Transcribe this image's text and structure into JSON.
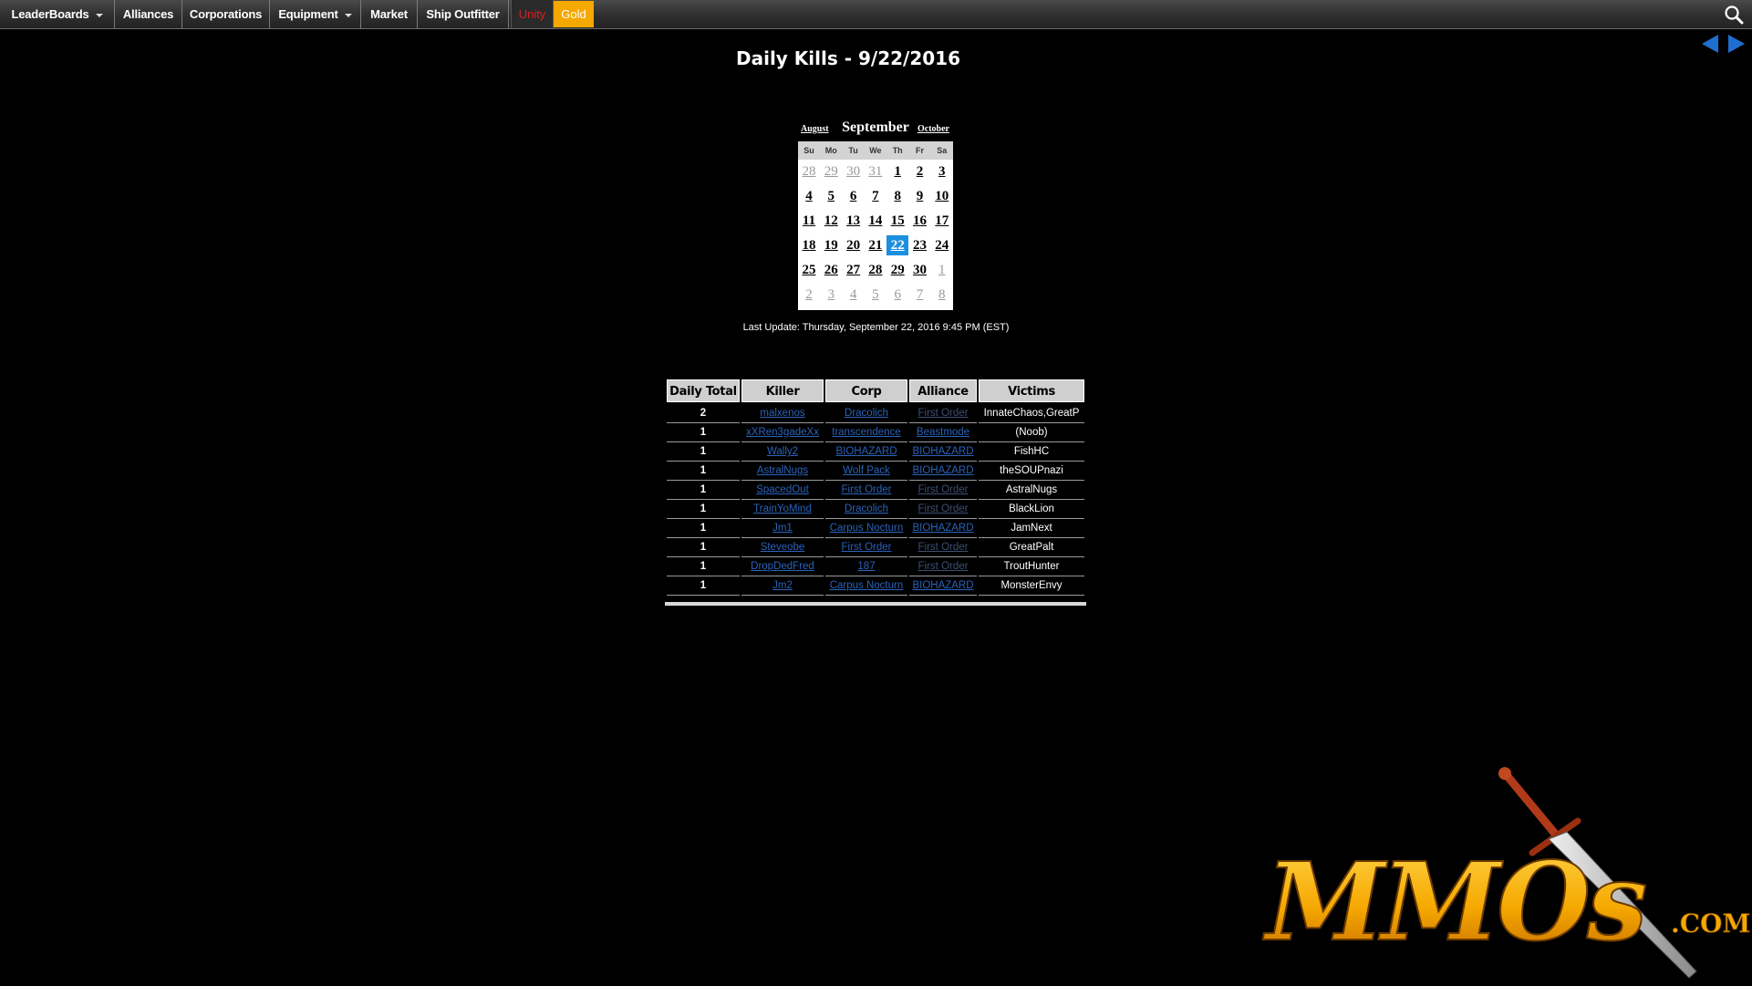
{
  "nav": {
    "items": [
      {
        "label": "LeaderBoards",
        "dropdown": true
      },
      {
        "label": "Alliances",
        "dropdown": false
      },
      {
        "label": "Corporations",
        "dropdown": false
      },
      {
        "label": "Equipment",
        "dropdown": true
      },
      {
        "label": "Market",
        "dropdown": false
      },
      {
        "label": "Ship Outfitter",
        "dropdown": false
      }
    ],
    "unity_label": "Unity",
    "gold_label": "Gold",
    "search_icon": "search-icon"
  },
  "page": {
    "title": "Daily Kills - 9/22/2016",
    "prev_icon": "left-arrow-icon",
    "next_icon": "right-arrow-icon"
  },
  "calendar": {
    "prev_month": "August",
    "month": "September",
    "next_month": "October",
    "weekdays": [
      "Su",
      "Mo",
      "Tu",
      "We",
      "Th",
      "Fr",
      "Sa"
    ],
    "weeks": [
      [
        {
          "d": "28",
          "cur": false
        },
        {
          "d": "29",
          "cur": false
        },
        {
          "d": "30",
          "cur": false
        },
        {
          "d": "31",
          "cur": false
        },
        {
          "d": "1",
          "cur": true
        },
        {
          "d": "2",
          "cur": true
        },
        {
          "d": "3",
          "cur": true
        }
      ],
      [
        {
          "d": "4",
          "cur": true
        },
        {
          "d": "5",
          "cur": true
        },
        {
          "d": "6",
          "cur": true
        },
        {
          "d": "7",
          "cur": true
        },
        {
          "d": "8",
          "cur": true
        },
        {
          "d": "9",
          "cur": true
        },
        {
          "d": "10",
          "cur": true
        }
      ],
      [
        {
          "d": "11",
          "cur": true
        },
        {
          "d": "12",
          "cur": true
        },
        {
          "d": "13",
          "cur": true
        },
        {
          "d": "14",
          "cur": true
        },
        {
          "d": "15",
          "cur": true
        },
        {
          "d": "16",
          "cur": true
        },
        {
          "d": "17",
          "cur": true
        }
      ],
      [
        {
          "d": "18",
          "cur": true
        },
        {
          "d": "19",
          "cur": true
        },
        {
          "d": "20",
          "cur": true
        },
        {
          "d": "21",
          "cur": true
        },
        {
          "d": "22",
          "cur": true,
          "selected": true
        },
        {
          "d": "23",
          "cur": true
        },
        {
          "d": "24",
          "cur": true
        }
      ],
      [
        {
          "d": "25",
          "cur": true
        },
        {
          "d": "26",
          "cur": true
        },
        {
          "d": "27",
          "cur": true
        },
        {
          "d": "28",
          "cur": true
        },
        {
          "d": "29",
          "cur": true
        },
        {
          "d": "30",
          "cur": true
        },
        {
          "d": "1",
          "cur": false
        }
      ],
      [
        {
          "d": "2",
          "cur": false
        },
        {
          "d": "3",
          "cur": false
        },
        {
          "d": "4",
          "cur": false
        },
        {
          "d": "5",
          "cur": false
        },
        {
          "d": "6",
          "cur": false
        },
        {
          "d": "7",
          "cur": false
        },
        {
          "d": "8",
          "cur": false
        }
      ]
    ],
    "selected_color": "#1b8fe0"
  },
  "last_update": "Last Update: Thursday, September 22, 2016 9:45 PM (EST)",
  "kills_table": {
    "headers": [
      "Daily Total",
      "Killer",
      "Corp",
      "Alliance",
      "Victims"
    ],
    "rows": [
      {
        "total": "2",
        "killer": "malxenos",
        "corp": "Dracolich",
        "alliance": "First Order",
        "alliance_dim": true,
        "victims": "InnateChaos,GreatP"
      },
      {
        "total": "1",
        "killer": "xXRen3gadeXx",
        "corp": "transcendence",
        "alliance": "Beastmode",
        "alliance_dim": false,
        "victims": "(Noob)"
      },
      {
        "total": "1",
        "killer": "Wally2",
        "corp": "BIOHAZARD",
        "alliance": "BIOHAZARD",
        "alliance_dim": false,
        "victims": "FishHC"
      },
      {
        "total": "1",
        "killer": "AstralNugs",
        "corp": "Wolf Pack",
        "alliance": "BIOHAZARD",
        "alliance_dim": false,
        "victims": "theSOUPnazi"
      },
      {
        "total": "1",
        "killer": "SpacedOut",
        "corp": "First Order",
        "alliance": "First Order",
        "alliance_dim": true,
        "victims": "AstralNugs"
      },
      {
        "total": "1",
        "killer": "TrainYoMind",
        "corp": "Dracolich",
        "alliance": "First Order",
        "alliance_dim": true,
        "victims": "BlackLion"
      },
      {
        "total": "1",
        "killer": "Jm1",
        "corp": "Carpus Nocturn",
        "alliance": "BIOHAZARD",
        "alliance_dim": false,
        "victims": "JamNext"
      },
      {
        "total": "1",
        "killer": "Steveobe",
        "corp": "First Order",
        "alliance": "First Order",
        "alliance_dim": true,
        "victims": "GreatPalt"
      },
      {
        "total": "1",
        "killer": "DropDedFred",
        "corp": "187",
        "alliance": "First Order",
        "alliance_dim": true,
        "victims": "TroutHunter"
      },
      {
        "total": "1",
        "killer": "Jm2",
        "corp": "Carpus Nocturn",
        "alliance": "BIOHAZARD",
        "alliance_dim": false,
        "victims": "MonsterEnvy"
      }
    ]
  },
  "logo": {
    "text": "MMOs",
    "suffix": ".COM",
    "colors": {
      "gold": "#f5a800",
      "blade": "#c0c0c0",
      "hilt": "#b03a1a"
    }
  }
}
